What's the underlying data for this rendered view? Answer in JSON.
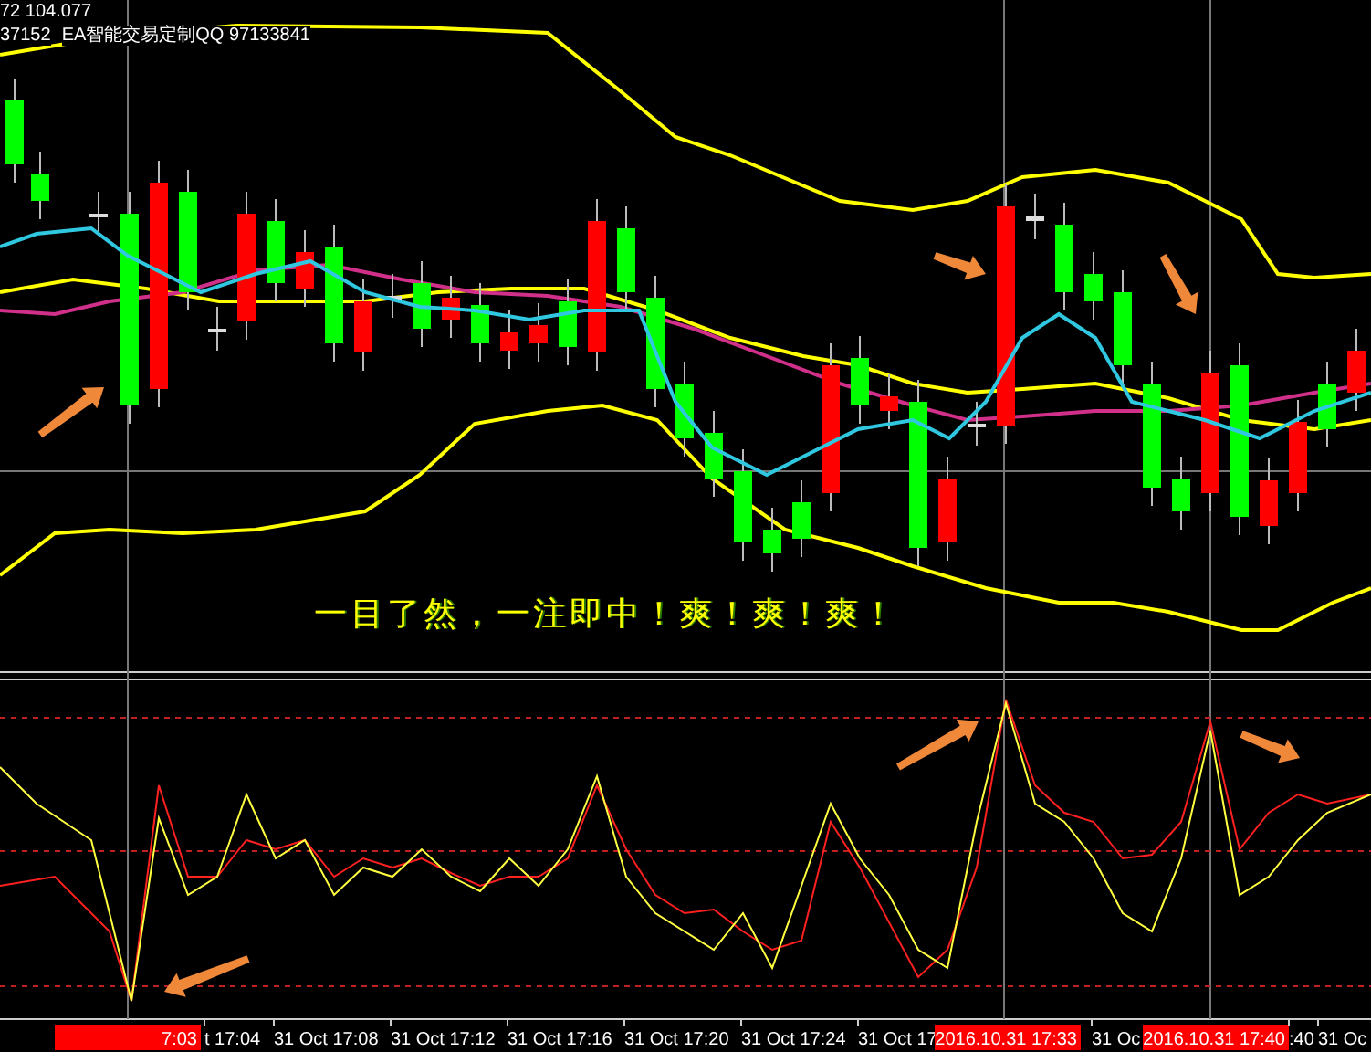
{
  "header": {
    "line_1": "72 104.077",
    "line_2": "37152",
    "line_3": "EA智能交易定制QQ 97133841"
  },
  "annotation": "一目了然，一注即中！爽！爽！爽！",
  "time_axis": [
    {
      "kind": "marker",
      "text": "7:03"
    },
    {
      "kind": "tick",
      "text": "t 17:04"
    },
    {
      "kind": "tick",
      "text": "31 Oct 17:08"
    },
    {
      "kind": "tick",
      "text": "31 Oct 17:12"
    },
    {
      "kind": "tick",
      "text": "31 Oct 17:16"
    },
    {
      "kind": "tick",
      "text": "31 Oct 17:20"
    },
    {
      "kind": "tick",
      "text": "31 Oct 17:24"
    },
    {
      "kind": "tick",
      "text": "31 Oct 17"
    },
    {
      "kind": "marker",
      "text": "2016.10.31 17:33"
    },
    {
      "kind": "tick",
      "text": "31 Oc"
    },
    {
      "kind": "marker",
      "text": "2016.10.31 17:40"
    },
    {
      "kind": "tick",
      "text": ":40"
    },
    {
      "kind": "tick",
      "text": "31 Oc"
    }
  ]
}
